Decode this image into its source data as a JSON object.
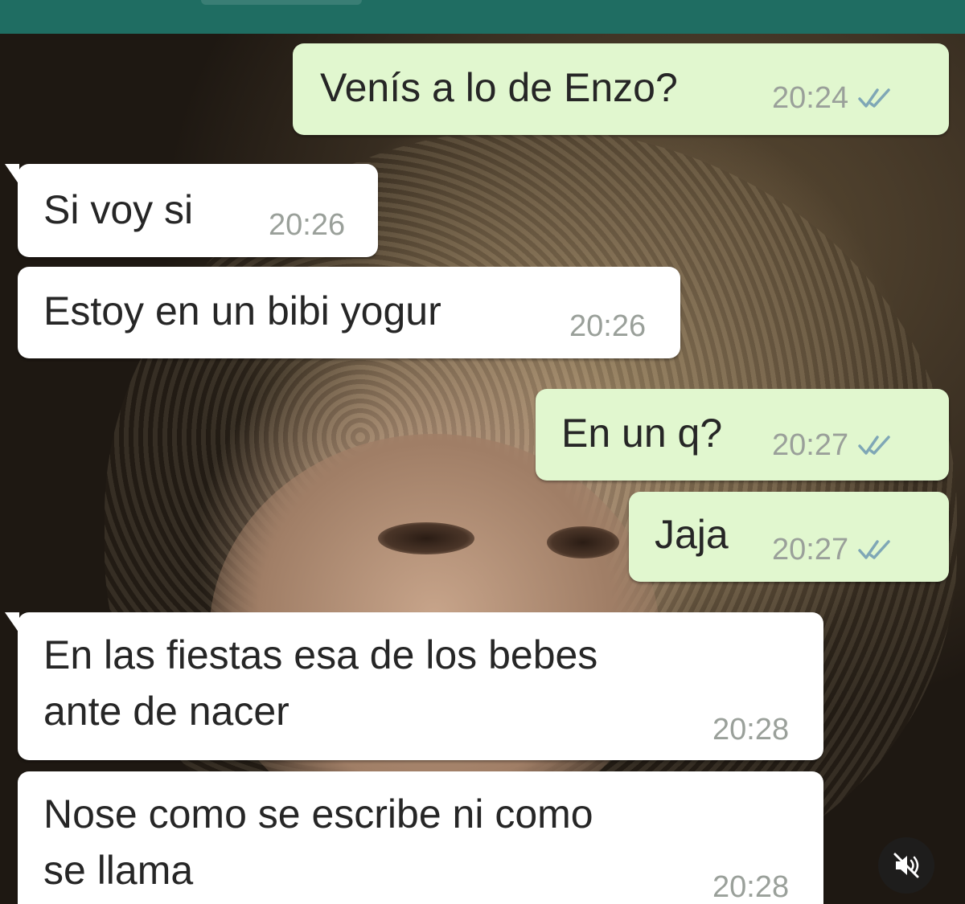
{
  "header": {
    "contact_name": ""
  },
  "messages": [
    {
      "direction": "out",
      "text": "Venís a lo de Enzo?",
      "time": "20:24",
      "status_icon": "double-check-icon"
    },
    {
      "direction": "in",
      "text": "Si voy si",
      "time": "20:26"
    },
    {
      "direction": "in",
      "text": "Estoy en un bibi yogur",
      "time": "20:26"
    },
    {
      "direction": "out",
      "text": "En un q?",
      "time": "20:27",
      "status_icon": "double-check-icon"
    },
    {
      "direction": "out",
      "text": "Jaja",
      "time": "20:27",
      "status_icon": "double-check-icon"
    },
    {
      "direction": "in",
      "text": "En las fiestas esa de los bebes\nante de nacer",
      "time": "20:28"
    },
    {
      "direction": "in",
      "text": "Nose como se escribe ni como\nse llama",
      "time": "20:28"
    }
  ],
  "controls": {
    "mute_icon": "speaker-muted-icon"
  },
  "colors": {
    "header": "#1f6d62",
    "outgoing_bubble": "#e1f7cf",
    "incoming_bubble": "#ffffff",
    "timestamp": "#9aa09a"
  }
}
